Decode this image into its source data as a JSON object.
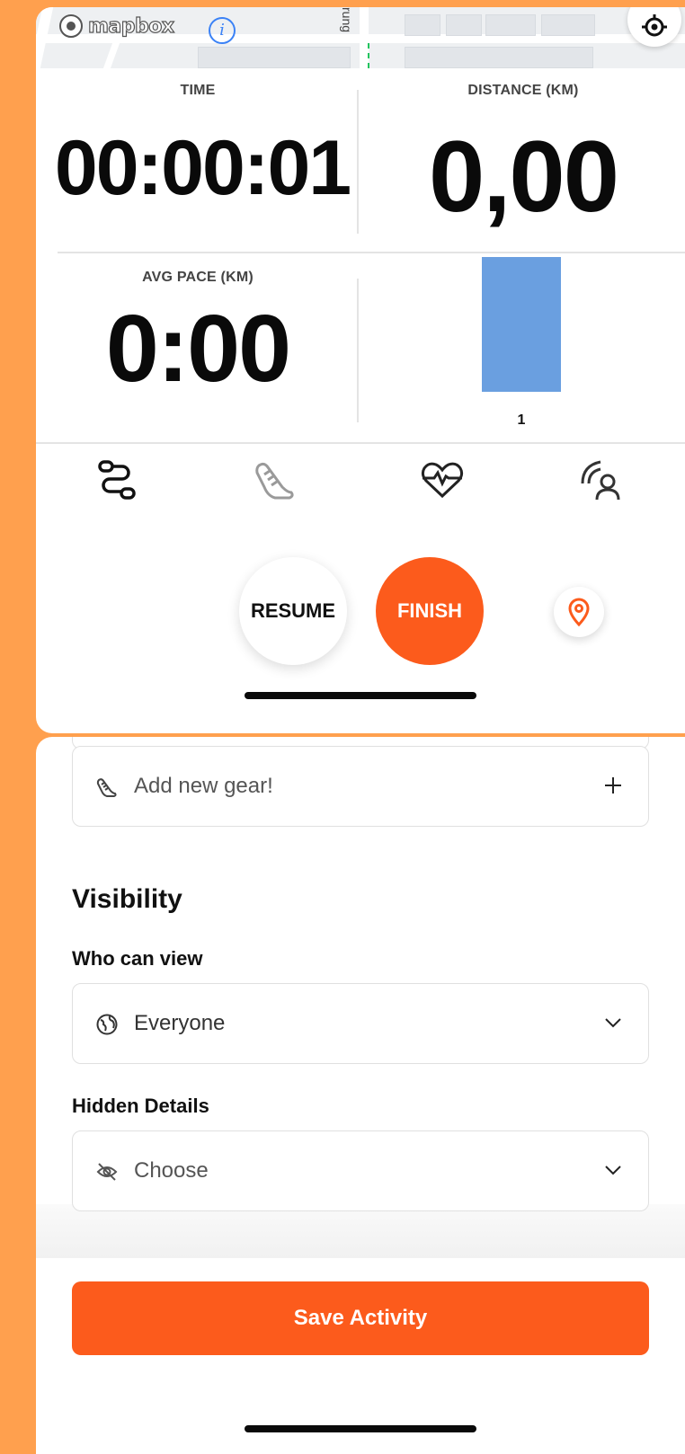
{
  "map": {
    "brand": "mapbox",
    "street_label": "rung",
    "info_icon": "info-icon",
    "locate_icon": "crosshair-icon"
  },
  "stats": {
    "time_label": "TIME",
    "time_value": "00:00:01",
    "distance_label": "DISTANCE (KM)",
    "distance_value": "0,00",
    "pace_label": "AVG PACE (KM)",
    "pace_value": "0:00"
  },
  "chart_data": {
    "type": "bar",
    "categories": [
      "1"
    ],
    "values": [
      1
    ],
    "ylim": [
      0,
      1
    ],
    "color": "#6a9fe0"
  },
  "tabs": [
    {
      "icon": "route-icon",
      "active": true
    },
    {
      "icon": "shoe-icon",
      "active": false
    },
    {
      "icon": "heart-rate-icon",
      "active": false
    },
    {
      "icon": "sensor-icon",
      "active": false
    }
  ],
  "controls": {
    "resume_label": "RESUME",
    "finish_label": "FINISH",
    "pin_icon": "location-pin-icon"
  },
  "form": {
    "gear_placeholder": "Add new gear!",
    "visibility_title": "Visibility",
    "who_can_view_label": "Who can view",
    "who_can_view_value": "Everyone",
    "hidden_details_label": "Hidden Details",
    "hidden_details_placeholder": "Choose",
    "save_label": "Save Activity"
  },
  "colors": {
    "accent": "#fc5b1c",
    "background": "#ffa04e",
    "bar": "#6a9fe0"
  }
}
